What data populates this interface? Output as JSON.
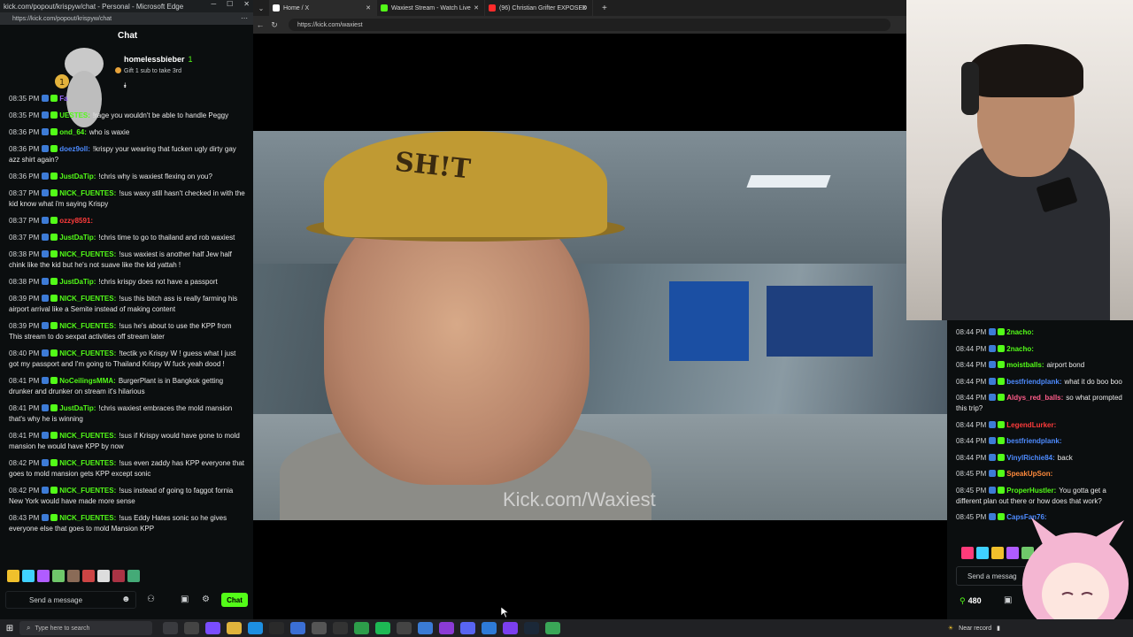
{
  "left_window": {
    "title": "kick.com/popout/krispyw/chat - Personal - Microsoft Edge",
    "url": "https://kick.com/popout/krispyw/chat",
    "chat_title": "Chat",
    "pinned": {
      "username": "homelessbieber",
      "count": "1",
      "gift_text": "Gift 1 sub to take 3rd"
    },
    "messages": [
      {
        "time": "08:35 PM",
        "user": "Fa",
        "user_color": "#9b6cff",
        "text": ""
      },
      {
        "time": "08:35 PM",
        "user": "UESTES:",
        "user_color": "#53fc18",
        "text": "!rage you wouldn't be able to handle Peggy"
      },
      {
        "time": "08:36 PM",
        "user": "ond_64:",
        "user_color": "#53fc18",
        "text": "who is waxie"
      },
      {
        "time": "08:36 PM",
        "user": "doez9oll:",
        "user_color": "#4d8bff",
        "text": "!krispy your wearing that fucken ugly dirty gay azz shirt again?"
      },
      {
        "time": "08:36 PM",
        "user": "JustDaTip:",
        "user_color": "#53fc18",
        "text": "!chris why is waxiest flexing on you?"
      },
      {
        "time": "08:37 PM",
        "user": "NICK_FUENTES:",
        "user_color": "#53fc18",
        "text": "!sus waxy still hasn't checked in with the kid know what i'm saying Krispy"
      },
      {
        "time": "08:37 PM",
        "user": "ozzy8591:",
        "user_color": "#ff3b3b",
        "text": ""
      },
      {
        "time": "08:37 PM",
        "user": "JustDaTip:",
        "user_color": "#53fc18",
        "text": "!chris time to go to thailand and rob waxiest"
      },
      {
        "time": "08:38 PM",
        "user": "NICK_FUENTES:",
        "user_color": "#53fc18",
        "text": "!sus waxiest is another half Jew half chink like the kid but he's not suave like the kid yattah !"
      },
      {
        "time": "08:38 PM",
        "user": "JustDaTip:",
        "user_color": "#53fc18",
        "text": "!chris krispy does not have a passport"
      },
      {
        "time": "08:39 PM",
        "user": "NICK_FUENTES:",
        "user_color": "#53fc18",
        "text": "!sus this bitch ass is really farming his airport arrival like a Semite instead of making content"
      },
      {
        "time": "08:39 PM",
        "user": "NICK_FUENTES:",
        "user_color": "#53fc18",
        "text": "!sus he's about to use the KPP from This stream to do sexpat activities off stream later"
      },
      {
        "time": "08:40 PM",
        "user": "NICK_FUENTES:",
        "user_color": "#53fc18",
        "text": "!tectik yo Krispy W ! guess what I just got my passport and I'm going to Thailand Krispy W fuck yeah dood !"
      },
      {
        "time": "08:41 PM",
        "user": "NoCeilingsMMA:",
        "user_color": "#53fc18",
        "text": "BurgerPlant is in Bangkok getting drunker and drunker on stream it's hilarious"
      },
      {
        "time": "08:41 PM",
        "user": "JustDaTip:",
        "user_color": "#53fc18",
        "text": "!chris waxiest embraces the mold mansion that's why he is winning"
      },
      {
        "time": "08:41 PM",
        "user": "NICK_FUENTES:",
        "user_color": "#53fc18",
        "text": "!sus if Krispy would have gone to mold mansion he would have KPP by now"
      },
      {
        "time": "08:42 PM",
        "user": "NICK_FUENTES:",
        "user_color": "#53fc18",
        "text": "!sus even zaddy has KPP everyone that goes to mold mansion gets KPP except sonic"
      },
      {
        "time": "08:42 PM",
        "user": "NICK_FUENTES:",
        "user_color": "#53fc18",
        "text": "!sus instead of going to faggot fornia New York would have made more sense"
      },
      {
        "time": "08:43 PM",
        "user": "NICK_FUENTES:",
        "user_color": "#53fc18",
        "text": "!sus Eddy Hates sonic so he gives everyone else that goes to mold Mansion KPP"
      }
    ],
    "input_placeholder": "Send a message",
    "chat_button": "Chat"
  },
  "browser": {
    "tabs": [
      {
        "label": "Home / X",
        "fav_color": "#ffffff"
      },
      {
        "label": "Waxiest Stream - Watch Live",
        "fav_color": "#53fc18"
      },
      {
        "label": "(96) Christian Grifter EXPOSED",
        "fav_color": "#ff2b2b"
      }
    ],
    "url": "https://kick.com/waxiest"
  },
  "stream": {
    "watermark": "Kick.com/Waxiest",
    "cap_text": "SH!T"
  },
  "right_chat": {
    "messages": [
      {
        "time": "08:44 PM",
        "user": "2nacho:",
        "user_color": "#53fc18",
        "text": ""
      },
      {
        "time": "08:44 PM",
        "user": "2nacho:",
        "user_color": "#53fc18",
        "text": ""
      },
      {
        "time": "08:44 PM",
        "user": "moistballs:",
        "user_color": "#53fc18",
        "text": "airport bond"
      },
      {
        "time": "08:44 PM",
        "user": "bestfriendplank:",
        "user_color": "#4d8bff",
        "text": "what it do boo boo"
      },
      {
        "time": "08:44 PM",
        "user": "Aldys_red_balls:",
        "user_color": "#ff5c8a",
        "text": "so what prompted this trip?"
      },
      {
        "time": "08:44 PM",
        "user": "LegendLurker:",
        "user_color": "#ff3b3b",
        "text": ""
      },
      {
        "time": "08:44 PM",
        "user": "bestfriendplank:",
        "user_color": "#4d8bff",
        "text": ""
      },
      {
        "time": "08:44 PM",
        "user": "VinylRichie84:",
        "user_color": "#4d8bff",
        "text": "back"
      },
      {
        "time": "08:45 PM",
        "user": "SpeakUpSon:",
        "user_color": "#ff8a3b",
        "text": ""
      },
      {
        "time": "08:45 PM",
        "user": "ProperHustler:",
        "user_color": "#53fc18",
        "text": "You gotta get a different plan out there or how does that work?"
      },
      {
        "time": "08:45 PM",
        "user": "CapsFan76:",
        "user_color": "#4d8bff",
        "text": ""
      }
    ],
    "input_placeholder": "Send a messag",
    "viewers": "480"
  },
  "taskbar": {
    "search_placeholder": "Type here to search",
    "tray_text": "Near record"
  }
}
